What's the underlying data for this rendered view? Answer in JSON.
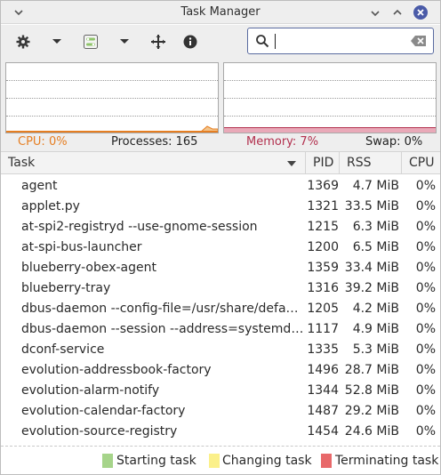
{
  "window": {
    "title": "Task Manager"
  },
  "search": {
    "value": "",
    "placeholder": ""
  },
  "stats": {
    "cpu": "CPU: 0%",
    "processes": "Processes: 165",
    "memory": "Memory: 7%",
    "swap": "Swap: 0%"
  },
  "table": {
    "headers": {
      "task": "Task",
      "pid": "PID",
      "rss": "RSS",
      "cpu": "CPU"
    },
    "rows": [
      {
        "task": "agent",
        "pid": "1369",
        "rss": "4.7 MiB",
        "cpu": "0%"
      },
      {
        "task": "applet.py",
        "pid": "1321",
        "rss": "33.5 MiB",
        "cpu": "0%"
      },
      {
        "task": "at-spi2-registryd --use-gnome-session",
        "pid": "1215",
        "rss": "6.3 MiB",
        "cpu": "0%"
      },
      {
        "task": "at-spi-bus-launcher",
        "pid": "1200",
        "rss": "6.5 MiB",
        "cpu": "0%"
      },
      {
        "task": "blueberry-obex-agent",
        "pid": "1359",
        "rss": "33.4 MiB",
        "cpu": "0%"
      },
      {
        "task": "blueberry-tray",
        "pid": "1316",
        "rss": "39.2 MiB",
        "cpu": "0%"
      },
      {
        "task": "dbus-daemon --config-file=/usr/share/default…",
        "pid": "1205",
        "rss": "4.2 MiB",
        "cpu": "0%"
      },
      {
        "task": "dbus-daemon --session --address=systemd: --…",
        "pid": "1117",
        "rss": "4.9 MiB",
        "cpu": "0%"
      },
      {
        "task": "dconf-service",
        "pid": "1335",
        "rss": "5.3 MiB",
        "cpu": "0%"
      },
      {
        "task": "evolution-addressbook-factory",
        "pid": "1496",
        "rss": "28.7 MiB",
        "cpu": "0%"
      },
      {
        "task": "evolution-alarm-notify",
        "pid": "1344",
        "rss": "52.8 MiB",
        "cpu": "0%"
      },
      {
        "task": "evolution-calendar-factory",
        "pid": "1487",
        "rss": "29.2 MiB",
        "cpu": "0%"
      },
      {
        "task": "evolution-source-registry",
        "pid": "1454",
        "rss": "24.6 MiB",
        "cpu": "0%"
      }
    ]
  },
  "legend": {
    "starting": "Starting task",
    "changing": "Changing task",
    "terminating": "Terminating task"
  },
  "colors": {
    "cpu": "#e67e22",
    "memory": "#b2304e",
    "starting": "#a6d48a",
    "changing": "#fbf08a",
    "terminating": "#e8686a",
    "close_button": "#4a5ba8"
  },
  "icons": [
    "collapse-icon",
    "minimize-icon",
    "maximize-icon",
    "close-icon",
    "gear-icon",
    "dropdown-arrow-icon",
    "view-settings-icon",
    "crosshair-icon",
    "info-icon",
    "search-icon",
    "clear-icon",
    "sort-descending-icon"
  ]
}
